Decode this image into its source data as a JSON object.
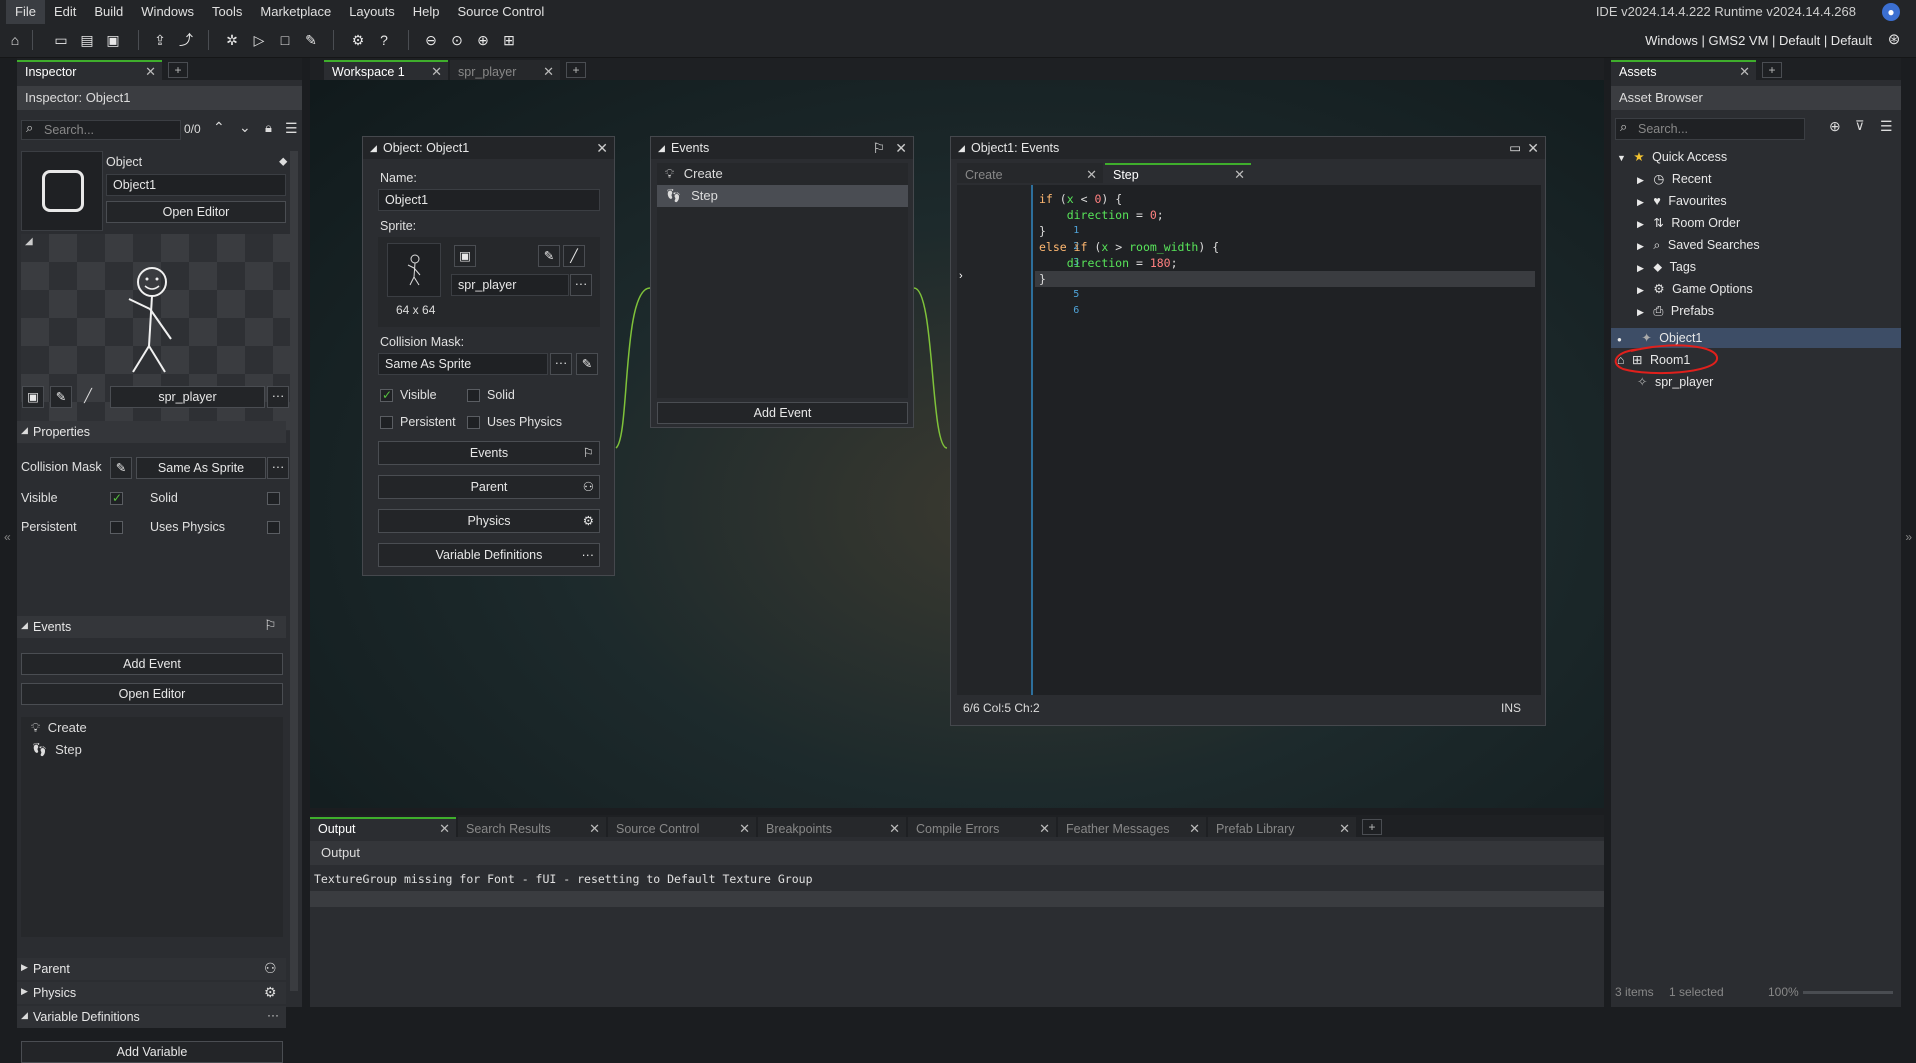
{
  "menu": {
    "items": [
      "File",
      "Edit",
      "Build",
      "Windows",
      "Tools",
      "Marketplace",
      "Layouts",
      "Help",
      "Source Control"
    ]
  },
  "ide": {
    "version": "IDE v2024.14.4.222  Runtime v2024.14.4.268",
    "targets": "Windows | GMS2 VM | Default | Default"
  },
  "inspector": {
    "tab": "Inspector",
    "title": "Inspector: Object1",
    "search_placeholder": "Search...",
    "match_count": "0/0",
    "object_label": "Object",
    "object_name": "Object1",
    "open_editor": "Open Editor",
    "sprite_name": "spr_player",
    "properties_header": "Properties",
    "collision_mask_label": "Collision Mask",
    "collision_mask_value": "Same As Sprite",
    "visible": "Visible",
    "solid": "Solid",
    "persistent": "Persistent",
    "uses_physics": "Uses Physics",
    "events_header": "Events",
    "add_event": "Add Event",
    "open_editor2": "Open Editor",
    "events": [
      "Create",
      "Step"
    ],
    "parent": "Parent",
    "physics": "Physics",
    "variable_definitions": "Variable Definitions",
    "add_variable": "Add Variable"
  },
  "workspace": {
    "tabs": [
      "Workspace 1",
      "spr_player"
    ]
  },
  "object_window": {
    "title": "Object: Object1",
    "name_label": "Name:",
    "name_value": "Object1",
    "sprite_label": "Sprite:",
    "sprite_size": "64 x 64",
    "sprite_value": "spr_player",
    "collision_label": "Collision Mask:",
    "collision_value": "Same As Sprite",
    "visible": "Visible",
    "solid": "Solid",
    "persistent": "Persistent",
    "uses_physics": "Uses Physics",
    "events_btn": "Events",
    "parent_btn": "Parent",
    "physics_btn": "Physics",
    "vardefs_btn": "Variable Definitions"
  },
  "events_window": {
    "title": "Events",
    "items": [
      "Create",
      "Step"
    ],
    "add_event": "Add Event"
  },
  "code_window": {
    "title": "Object1: Events",
    "tabs": [
      "Create",
      "Step"
    ],
    "status": "6/6 Col:5 Ch:2",
    "mode": "INS",
    "line_numbers": [
      "1",
      "2",
      "3",
      "4",
      "5",
      "6"
    ]
  },
  "output": {
    "tabs": [
      "Output",
      "Search Results",
      "Source Control",
      "Breakpoints",
      "Compile Errors",
      "Feather Messages",
      "Prefab Library"
    ],
    "header": "Output",
    "message": "TextureGroup missing for Font - fUI - resetting to Default Texture Group"
  },
  "assets": {
    "tab": "Assets",
    "title": "Asset Browser",
    "search_placeholder": "Search...",
    "quick_access": "Quick Access",
    "quick_items": [
      "Recent",
      "Favourites",
      "Room Order",
      "Saved Searches",
      "Tags",
      "Game Options",
      "Prefabs"
    ],
    "items": [
      "Object1",
      "Room1",
      "spr_player"
    ],
    "footer_items": "3 items",
    "footer_selected": "1 selected",
    "zoom": "100%"
  },
  "colors": {
    "accent": "#3fae2c",
    "selection": "#3d4d66",
    "annotation": "#e0201c"
  }
}
